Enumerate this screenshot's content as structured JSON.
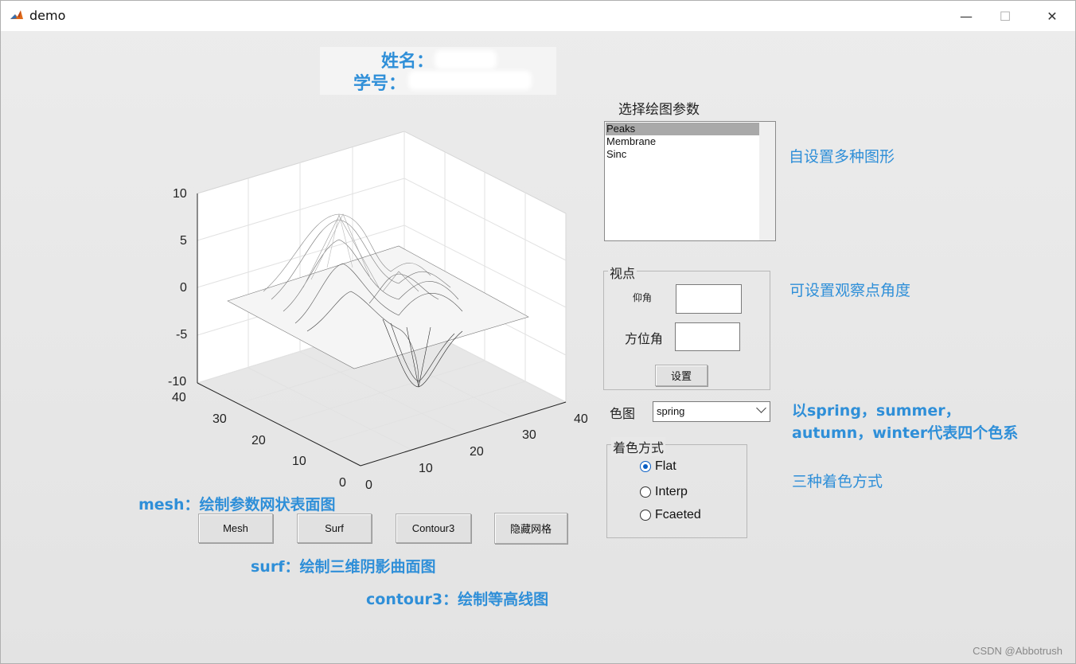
{
  "window": {
    "title": "demo",
    "minimize_glyph": "—",
    "maximize_glyph": "☐",
    "close_glyph": "✕",
    "app_icon": "matlab-icon"
  },
  "header": {
    "name_label": "姓名：",
    "id_label": "学号："
  },
  "plot": {
    "z_ticks": [
      "10",
      "5",
      "0",
      "-5",
      "-10"
    ],
    "y_ticks": [
      "40",
      "30",
      "20",
      "10",
      "0"
    ],
    "x_ticks": [
      "0",
      "10",
      "20",
      "30",
      "40"
    ]
  },
  "annotations": {
    "mesh": "mesh：绘制参数网状表面图",
    "surf": "surf：绘制三维阴影曲面图",
    "contour3": "contour3：绘制等高线图",
    "shapes": "自设置多种图形",
    "viewpoint": "可设置观察点角度",
    "colormap_line1": "以spring，summer，",
    "colormap_line2": "autumn，winter代表四个色系",
    "shading": "三种着色方式"
  },
  "buttons": {
    "mesh": "Mesh",
    "surf": "Surf",
    "contour3": "Contour3",
    "hide_grid": "隐藏网格",
    "set": "设置"
  },
  "plot_params": {
    "title": "选择绘图参数",
    "items": [
      {
        "label": "Peaks",
        "selected": true
      },
      {
        "label": "Membrane",
        "selected": false
      },
      {
        "label": "Sinc",
        "selected": false
      }
    ]
  },
  "viewpoint": {
    "title": "视点",
    "elevation_label": "仰角",
    "azimuth_label": "方位角",
    "elevation_value": "",
    "azimuth_value": ""
  },
  "colormap": {
    "label": "色图",
    "selected": "spring"
  },
  "shading": {
    "title": "着色方式",
    "options": [
      {
        "label": "Flat",
        "checked": true
      },
      {
        "label": "Interp",
        "checked": false
      },
      {
        "label": "Fcaeted",
        "checked": false
      }
    ]
  },
  "watermark": "CSDN @Abbotrush"
}
